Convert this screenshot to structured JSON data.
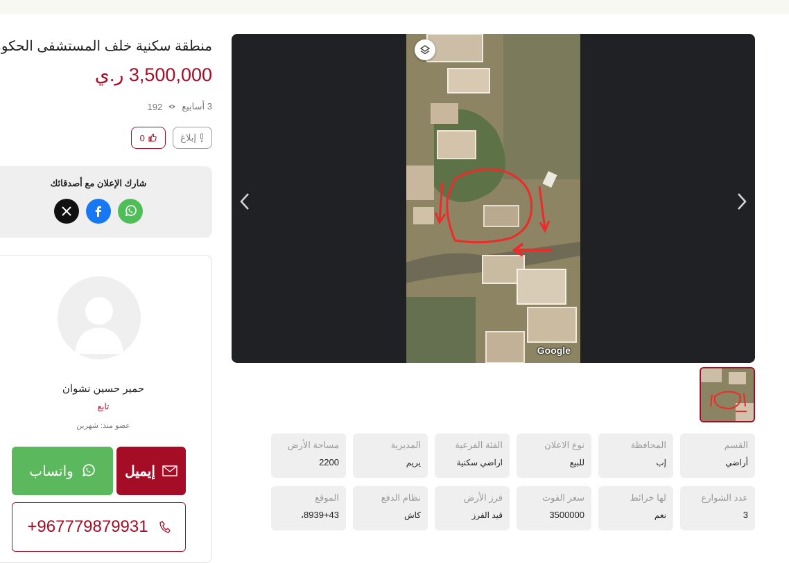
{
  "listing": {
    "title": "منطقة سكنية خلف المستشفى الحكومي",
    "price": "3,500,000 ر.ي",
    "age": "3 أسابيع",
    "views": "192",
    "report_label": "إبلاغ",
    "likes": "0"
  },
  "share": {
    "title": "شارك الإعلان مع أصدقائك",
    "icons": [
      "whatsapp-icon",
      "facebook-icon",
      "x-icon"
    ]
  },
  "seller": {
    "name": "حمير حسين نشوان",
    "follow_label": "تابع",
    "member_since": "عضو منذ: شهرين",
    "whatsapp_label": "واتساب",
    "email_label": "إيميل",
    "phone": "+967779879931"
  },
  "gallery": {
    "watermark": "Google",
    "thumbnail_count": 1
  },
  "details": [
    {
      "label": "القسم",
      "value": "أراضي"
    },
    {
      "label": "المحافظة",
      "value": "إب"
    },
    {
      "label": "نوع الاعلان",
      "value": "للبيع"
    },
    {
      "label": "الفئة الفرعية",
      "value": "اراضي سكنية"
    },
    {
      "label": "المديرية",
      "value": "يريم"
    },
    {
      "label": "مساحة الأرض",
      "value": "2200"
    },
    {
      "label": "عدد الشوارع",
      "value": "3"
    },
    {
      "label": "لها خرائط",
      "value": "نعم"
    },
    {
      "label": "سعر الفوت",
      "value": "3500000"
    },
    {
      "label": "فرز الأرض",
      "value": "قيد الفرز"
    },
    {
      "label": "نظام الدفع",
      "value": "كاش"
    },
    {
      "label": "الموقع",
      "value": "8939+43،"
    }
  ],
  "colors": {
    "brand": "#a50d26",
    "whatsapp": "#5cb85c",
    "facebook": "#1877f2",
    "gallery_bg": "#1f2124",
    "panel_bg": "#efefef"
  }
}
